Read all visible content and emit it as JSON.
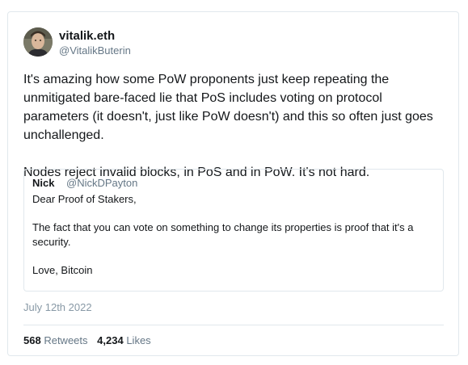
{
  "author": {
    "name": "vitalik.eth",
    "handle": "@VitalikButerin",
    "avatar_icon": "user-avatar-photo"
  },
  "tweet": {
    "paragraphs": [
      "It's amazing how some PoW proponents just keep repeating the unmitigated bare-faced lie that PoS includes voting on protocol parameters (it doesn't, just like PoW doesn't) and this so often just goes unchallenged.",
      "Nodes reject invalid blocks, in PoS and in PoW. It's not hard."
    ],
    "date": "July 12th 2022"
  },
  "quoted_tweet": {
    "name": "Nick",
    "handle": "@NickDPayton",
    "paragraphs": [
      "Dear Proof of Stakers,",
      "The fact that you can vote on something to change its properties is proof that it's a security.",
      "Love, Bitcoin"
    ]
  },
  "stats": {
    "retweets_count": "568",
    "retweets_label": "Retweets",
    "likes_count": "4,234",
    "likes_label": "Likes"
  },
  "colors": {
    "text": "#14171a",
    "secondary_text": "#657786",
    "date_text": "#8899a6",
    "border": "#e1e8ed"
  }
}
